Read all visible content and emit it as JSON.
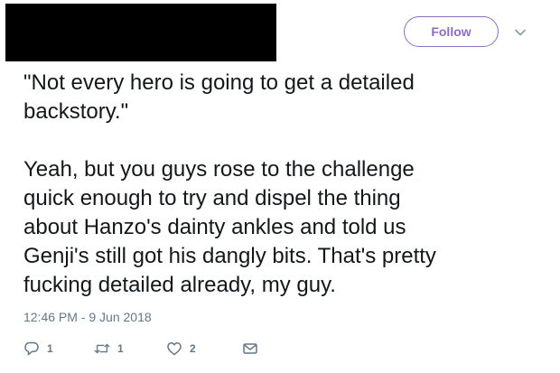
{
  "header": {
    "follow_label": "Follow"
  },
  "tweet": {
    "paragraphs": [
      "\"Not every hero is going to get a detailed\nbackstory.\"",
      "Yeah, but you guys rose to the challenge\nquick enough to try and dispel the thing\nabout Hanzo's dainty ankles and told us\nGenji's still got his dangly bits. That's pretty\nfucking detailed already, my guy."
    ],
    "timestamp": "12:46 PM - 9 Jun 2018"
  },
  "actions": {
    "reply_count": "1",
    "retweet_count": "1",
    "like_count": "2"
  },
  "colors": {
    "follow_accent": "#8c6fbf",
    "secondary_text": "#657786",
    "body_text": "#14171a"
  },
  "icons": [
    "chevron-down-icon",
    "reply-icon",
    "retweet-icon",
    "heart-icon",
    "envelope-icon"
  ]
}
